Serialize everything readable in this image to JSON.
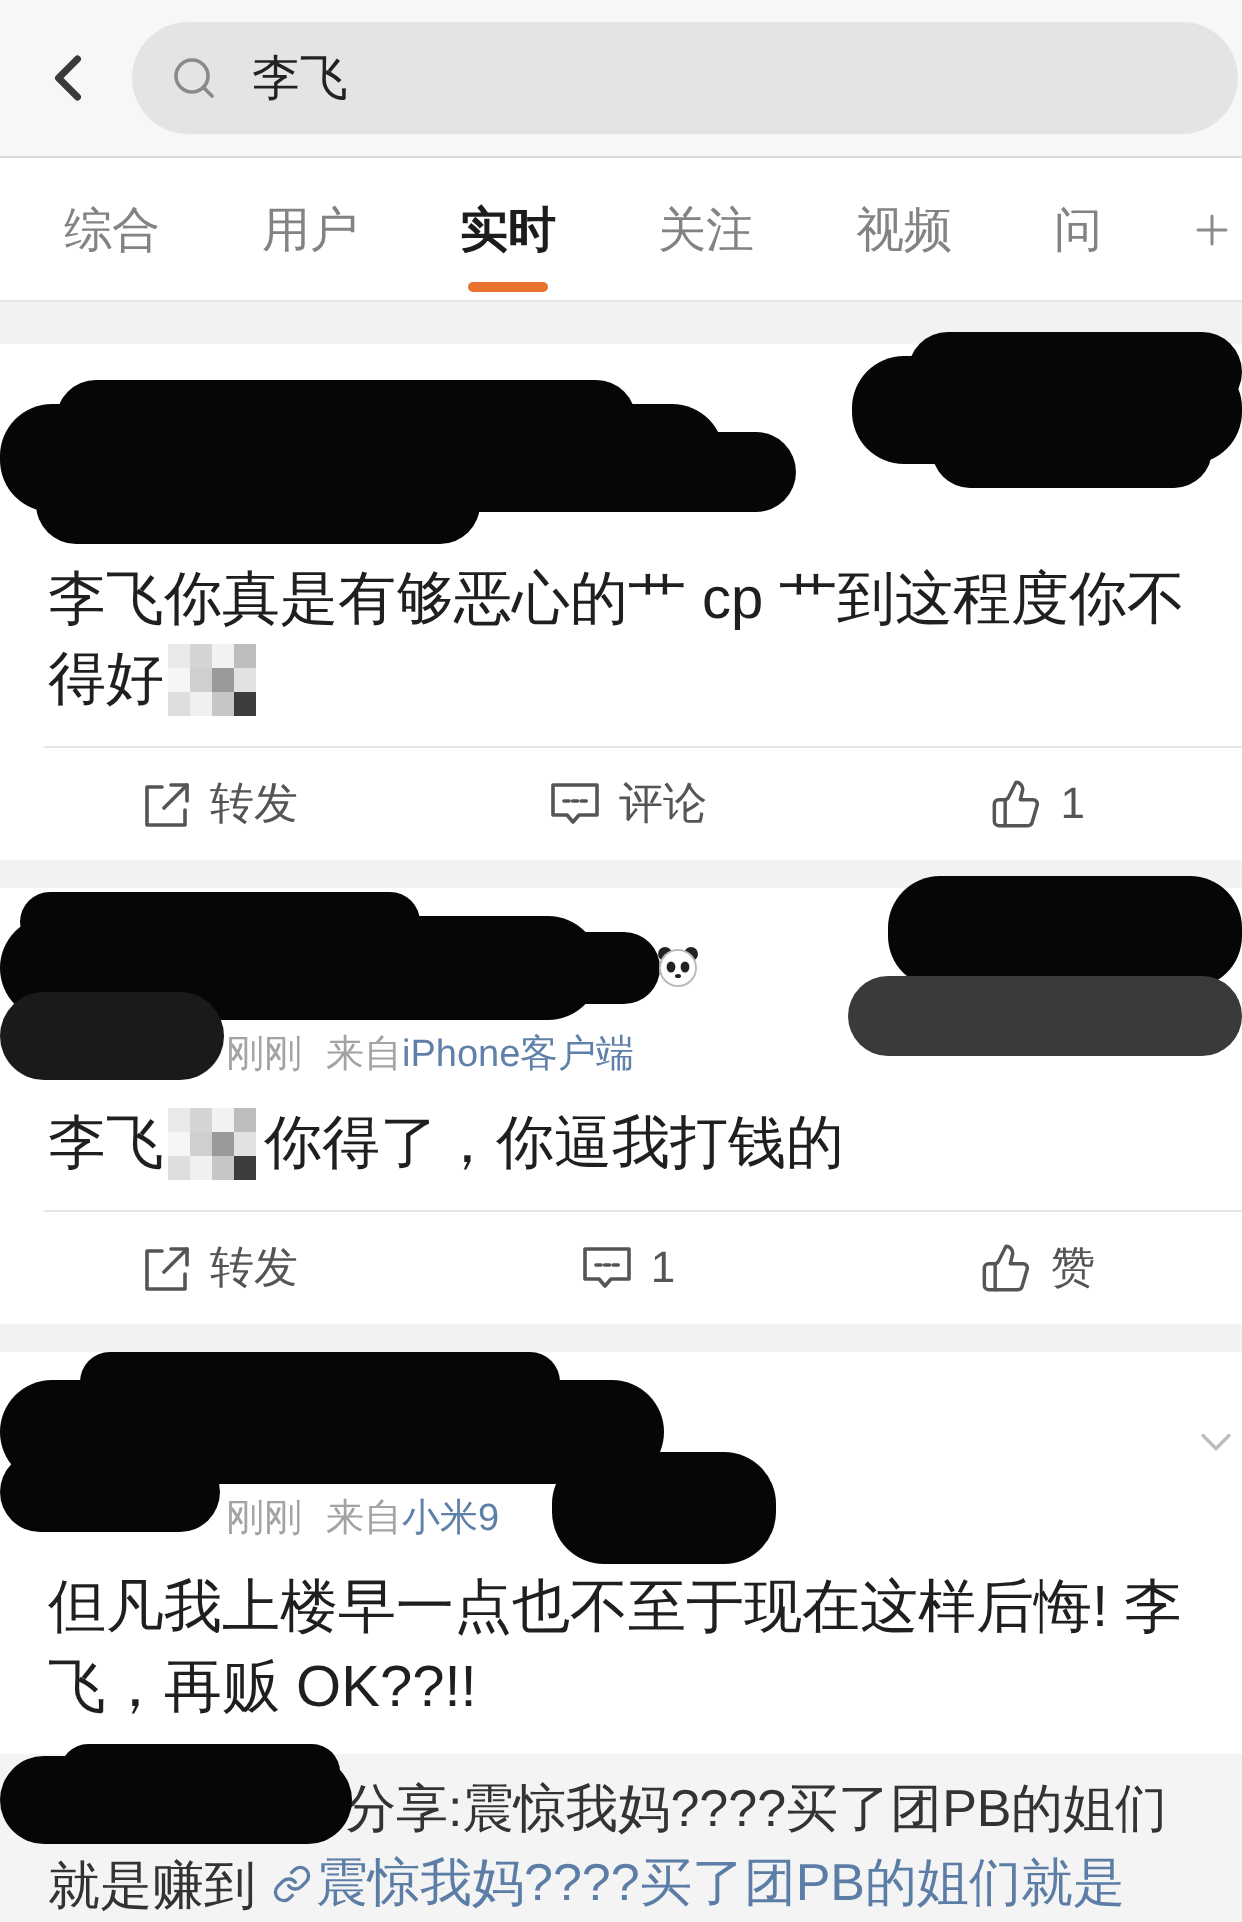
{
  "search": {
    "value": "李飞"
  },
  "tabs": [
    {
      "label": "综合",
      "selected": false
    },
    {
      "label": "用户",
      "selected": false
    },
    {
      "label": "实时",
      "selected": true
    },
    {
      "label": "关注",
      "selected": false
    },
    {
      "label": "视频",
      "selected": false
    },
    {
      "label": "问",
      "selected": false
    }
  ],
  "posts": [
    {
      "redacted": true,
      "content": [
        {
          "kind": "text",
          "text": "李飞你真是有够恶心的艹 cp 艹到这程度你不"
        },
        {
          "kind": "text",
          "text": "得好"
        },
        {
          "kind": "mosaic"
        }
      ],
      "actions": [
        {
          "kind": "repost",
          "label": "转发"
        },
        {
          "kind": "comment",
          "label": "评论"
        },
        {
          "kind": "like",
          "label": "1"
        }
      ]
    },
    {
      "redacted": true,
      "author_emoji": true,
      "meta": {
        "time": "刚刚",
        "via": "来自",
        "source": "iPhone客户端"
      },
      "content": [
        {
          "kind": "text",
          "text": "李飞"
        },
        {
          "kind": "mosaic"
        },
        {
          "kind": "text",
          "text": "你得了，你逼我打钱的"
        }
      ],
      "actions": [
        {
          "kind": "repost",
          "label": "转发"
        },
        {
          "kind": "comment",
          "label": "1"
        },
        {
          "kind": "like",
          "label": "赞"
        }
      ]
    },
    {
      "redacted": true,
      "has_menu": true,
      "meta": {
        "time": "刚刚",
        "via": "来自",
        "source": "小米9"
      },
      "content": [
        {
          "kind": "text",
          "text": "但凡我上楼早一点也不至于现在这样后悔! 李飞，再贩 OK??!!"
        }
      ],
      "repost": {
        "redacted": true,
        "text": "分享:震惊我妈????买了团PB的姐们就是赚到",
        "link": "震惊我妈????买了团PB的姐们就是"
      }
    }
  ]
}
